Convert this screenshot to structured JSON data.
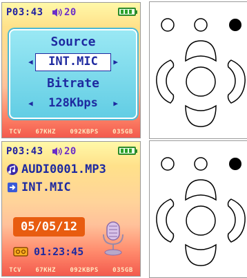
{
  "colors": {
    "accent": "#1e2aa0",
    "date_bg": "#e85c10",
    "panel": "#62cde4"
  },
  "screen1": {
    "time": "P03:43",
    "volume": "20",
    "source_label": "Source",
    "source_value": "INT.MIC",
    "bitrate_label": "Bitrate",
    "bitrate_value": "128Kbps",
    "footer": [
      "TCV",
      "67KHZ",
      "092KBPS",
      "035GB"
    ]
  },
  "screen2": {
    "time": "P03:43",
    "volume": "20",
    "filename": "AUDI0001.MP3",
    "source": "INT.MIC",
    "date": "05/05/12",
    "elapsed": "01:23:45",
    "footer": [
      "TCV",
      "67KHZ",
      "092KBPS",
      "035GB"
    ]
  },
  "icons": [
    "speaker-icon",
    "battery-icon",
    "left-arrow-icon",
    "right-arrow-icon",
    "music-note-icon",
    "input-icon",
    "tape-icon",
    "microphone-icon"
  ]
}
